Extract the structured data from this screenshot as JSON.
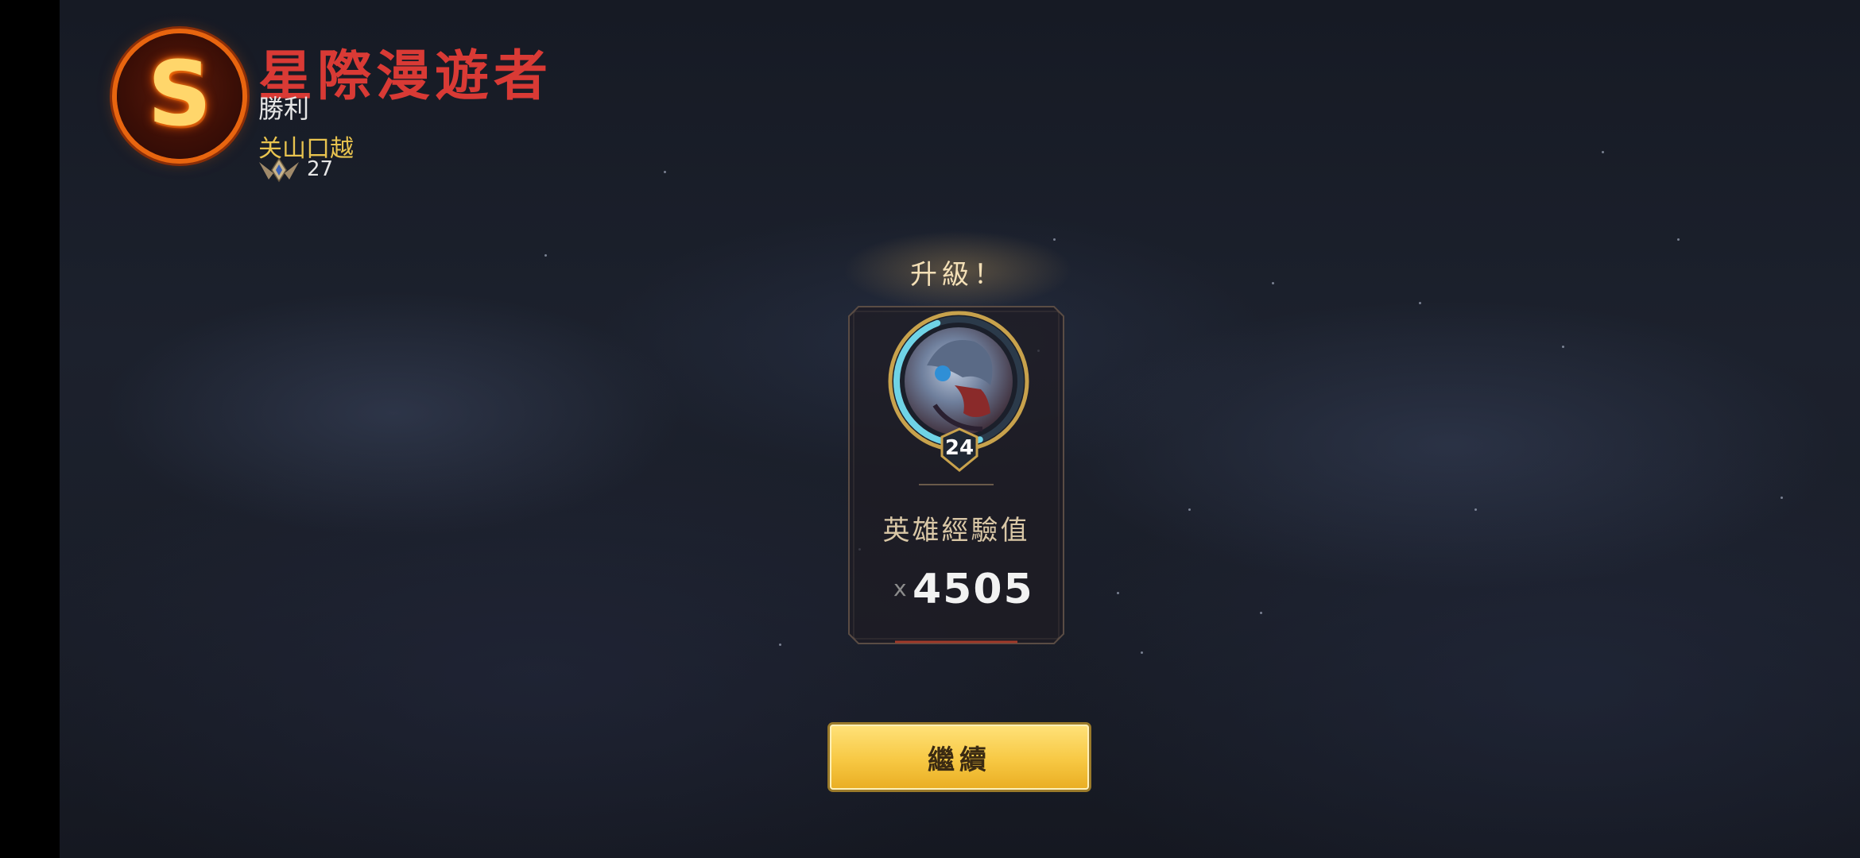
{
  "match_result": {
    "rank_grade": "S",
    "skin_name": "星際漫遊者",
    "result": "勝利",
    "player_name": "关山口越",
    "player_level": "27"
  },
  "level_up": {
    "title": "升級！",
    "hero_level": "24",
    "exp_label": "英雄經驗值",
    "exp_multiplier": "x",
    "exp_value": "4505",
    "progress_fraction": 0.5
  },
  "actions": {
    "continue_label": "繼續"
  },
  "colors": {
    "rank_ring": "#e8650f",
    "skin_name": "#d93a35",
    "player_name": "#e8c34f",
    "exp_ring": "#6fd3e6",
    "button": "#f7c843"
  }
}
